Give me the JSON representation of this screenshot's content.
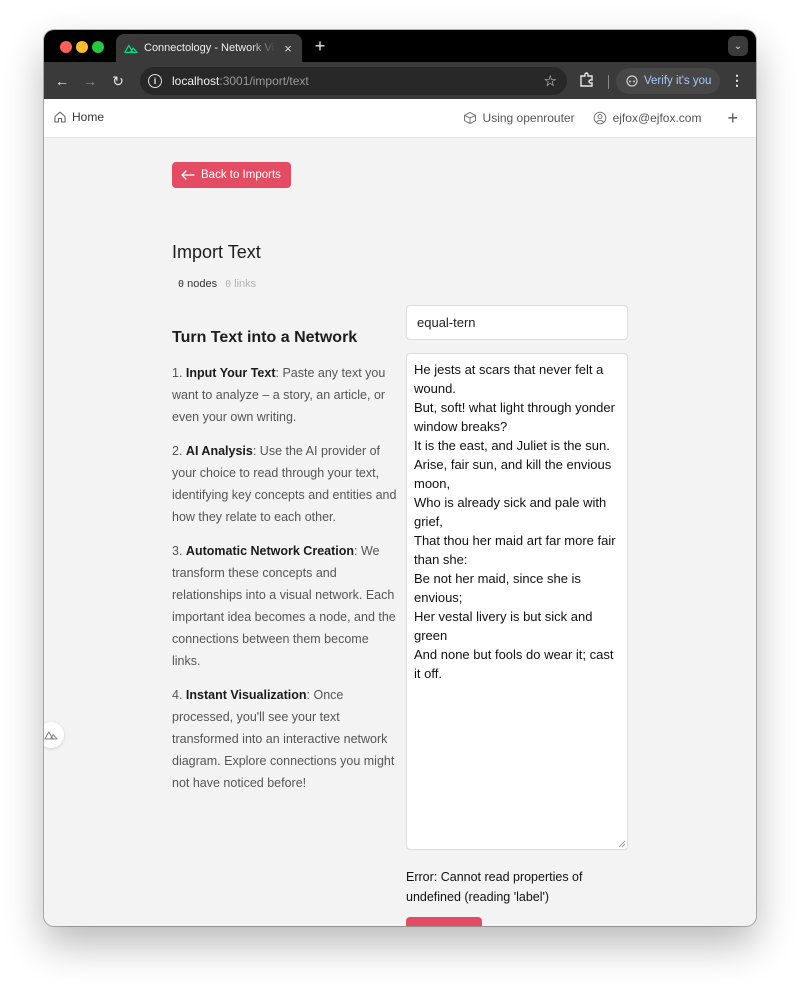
{
  "browser": {
    "tab_title": "Connectology - Network Visualization",
    "tab_close": "×",
    "new_tab": "+",
    "url_host": "localhost",
    "url_rest": ":3001/import/text",
    "verify_label": "Verify it's you",
    "menu": "⋮",
    "back": "←",
    "forward": "→",
    "reload": "↻",
    "star": "☆",
    "tab_search": "⌄"
  },
  "nav": {
    "home_label": "Home",
    "provider_label": "Using openrouter",
    "user_label": "ejfox@ejfox.com",
    "add_label": "+"
  },
  "page": {
    "back_label": "Back to Imports",
    "title": "Import Text",
    "nodes_count": "0",
    "nodes_label": "nodes",
    "links_count": "0",
    "links_label": "links",
    "section_title": "Turn Text into a Network",
    "steps": [
      {
        "title": "Input Your Text",
        "num": "1.",
        "text": ": Paste any text you want to analyze – a story, an article, or even your own writing."
      },
      {
        "title": "AI Analysis",
        "num": "2.",
        "text": ": Use the AI provider of your choice to read through your text, identifying key concepts and entities and how they relate to each other."
      },
      {
        "title": "Automatic Network Creation",
        "num": "3.",
        "text": ": We transform these concepts and relationships into a visual network. Each important idea becomes a node, and the connections between them become links."
      },
      {
        "title": "Instant Visualization",
        "num": "4.",
        "text": ": Once processed, you'll see your text transformed into an interactive network diagram. Explore connections you might not have noticed before!"
      }
    ],
    "name_value": "equal-tern",
    "text_value": "He jests at scars that never felt a wound.\nBut, soft! what light through yonder window breaks?\nIt is the east, and Juliet is the sun.\nArise, fair sun, and kill the envious moon,\nWho is already sick and pale with grief,\nThat thou her maid art far more fair than she:\nBe not her maid, since she is envious;\nHer vestal livery is but sick and green\nAnd none but fools do wear it; cast it off.",
    "error": "Error: Cannot read properties of undefined (reading 'label')"
  },
  "colors": {
    "accent": "#e34c63",
    "verify_text": "#a8c7fa"
  },
  "icons": {
    "tab": "nuxt-logo-icon",
    "home": "home-icon",
    "provider": "cube-icon",
    "user": "user-circle-icon",
    "back": "arrow-left-icon"
  }
}
